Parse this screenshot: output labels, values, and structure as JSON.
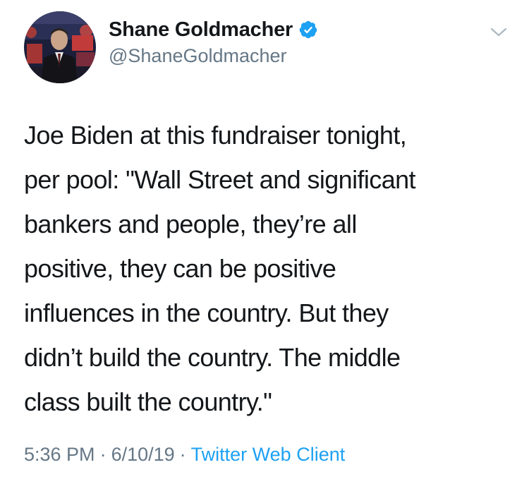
{
  "author": {
    "display_name": "Shane Goldmacher",
    "handle": "@ShaneGoldmacher",
    "verified": true,
    "avatar_icon": "user-avatar-photo"
  },
  "tweet": {
    "lines": [
      "Joe Biden at this fundraiser tonight,",
      "per pool: \"Wall Street and significant",
      "bankers and people, they’re all",
      "positive, they can be positive",
      "influences in the country. But they",
      "didn’t build the country. The middle",
      "class built the country.\""
    ]
  },
  "meta": {
    "time": "5:36 PM",
    "separator": "·",
    "date": "6/10/19",
    "source": "Twitter Web Client"
  },
  "icons": {
    "verified": "verified-badge-icon",
    "menu": "chevron-down-icon"
  },
  "colors": {
    "text_primary": "#14171a",
    "text_secondary": "#657786",
    "accent": "#1da1f2"
  }
}
